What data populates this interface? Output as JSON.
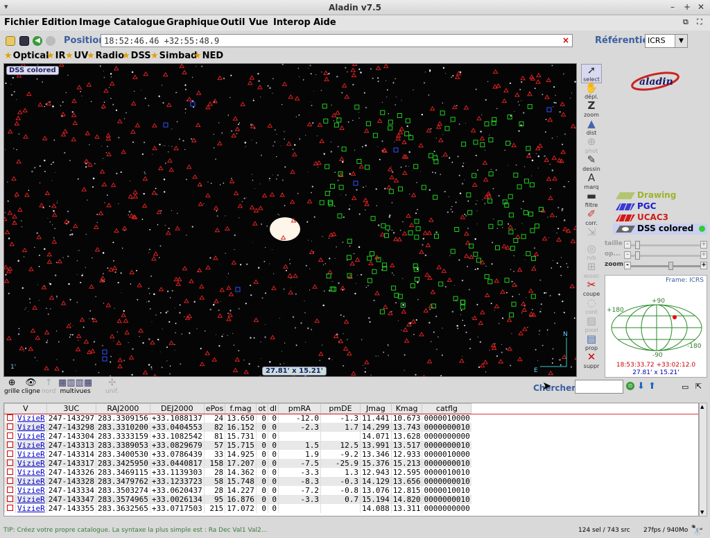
{
  "window": {
    "title": "Aladin v7.5"
  },
  "menu": [
    "Fichier",
    "Edition",
    "Image",
    "Catalogue",
    "Graphique",
    "Outil",
    "Vue",
    "Interop",
    "Aide"
  ],
  "position": {
    "label": "Position",
    "value": "18:52:46.46 +32:55:48.9",
    "clear": "×"
  },
  "frame": {
    "label": "Référentiel",
    "value": "ICRS"
  },
  "surveys": [
    "Optical",
    "IR",
    "UV",
    "Radio",
    "DSS",
    "Simbad",
    "NED"
  ],
  "view": {
    "tag": "DSS colored",
    "fov": "27.81' x 15.21'",
    "scale": "1'"
  },
  "tools": [
    {
      "label": "select",
      "glyph": "➚"
    },
    {
      "label": "dépl.",
      "glyph": "✋"
    },
    {
      "label": "zoom",
      "glyph": "Z"
    },
    {
      "label": "dist",
      "glyph": "▲"
    },
    {
      "label": "phot",
      "glyph": "⊕"
    },
    {
      "label": "dessin",
      "glyph": "✎"
    },
    {
      "label": "marq",
      "glyph": "A"
    },
    {
      "label": "filtre",
      "glyph": "▬"
    },
    {
      "label": "corr.",
      "glyph": "✐"
    },
    {
      "label": "",
      "glyph": "⇲"
    },
    {
      "label": "rvb",
      "glyph": "◎"
    },
    {
      "label": "assoc",
      "glyph": "⊞"
    },
    {
      "label": "coupe",
      "glyph": "✂"
    },
    {
      "label": "cont",
      "glyph": "◌"
    },
    {
      "label": "pixel",
      "glyph": "▨"
    },
    {
      "label": "prop",
      "glyph": "▤"
    },
    {
      "label": "suppr",
      "glyph": "✕"
    }
  ],
  "layers": [
    {
      "name": "Drawing",
      "color": "#9bb52a"
    },
    {
      "name": "PGC",
      "color": "#1a1ad0"
    },
    {
      "name": "UCAC3",
      "color": "#d01a1a"
    },
    {
      "name": "DSS colored",
      "color": "#000000"
    }
  ],
  "sliders": [
    {
      "label": "taille"
    },
    {
      "label": "op..."
    },
    {
      "label": "zoom"
    }
  ],
  "overview": {
    "frame": "Frame: ICRS",
    "top": "+90",
    "bottom": "-90",
    "left": "+180",
    "right": "-180",
    "coord1": "18:53:33.72 +33:02:12.0",
    "coord2": "27.81' x 15.21'"
  },
  "bottom_tools": [
    {
      "label": "grille",
      "glyph": "⊕"
    },
    {
      "label": "cligne",
      "glyph": "👁"
    },
    {
      "label": "nord",
      "glyph": "↑"
    },
    {
      "label": "multivues",
      "glyph": "▦▥▥▦"
    },
    {
      "label": "unif.",
      "glyph": "✣"
    }
  ],
  "search": {
    "label": "Chercher"
  },
  "table": {
    "headers": [
      "V",
      "3UC",
      "RAJ2000",
      "DEJ2000",
      "ePos",
      "f.mag",
      "ot",
      "dl",
      "pmRA",
      "pmDE",
      "Jmag",
      "Kmag",
      "catflg"
    ],
    "rows": [
      [
        "VizieR",
        "247-143297",
        "283.3309156",
        "+33.1088137",
        "24",
        "13.650",
        "0",
        "0",
        "-12.0",
        "-1.3",
        "11.441",
        "10.673",
        "0000010000"
      ],
      [
        "VizieR",
        "247-143298",
        "283.3310200",
        "+33.0404553",
        "82",
        "16.152",
        "0",
        "0",
        "-2.3",
        "1.7",
        "14.299",
        "13.743",
        "0000000010"
      ],
      [
        "VizieR",
        "247-143304",
        "283.3333159",
        "+33.1082542",
        "81",
        "15.731",
        "0",
        "0",
        "",
        "",
        "14.071",
        "13.628",
        "0000000000"
      ],
      [
        "VizieR",
        "247-143313",
        "283.3389053",
        "+33.0829679",
        "57",
        "15.715",
        "0",
        "0",
        "1.5",
        "12.5",
        "13.991",
        "13.517",
        "0000000010"
      ],
      [
        "VizieR",
        "247-143314",
        "283.3400530",
        "+33.0786439",
        "33",
        "14.925",
        "0",
        "0",
        "1.9",
        "-9.2",
        "13.346",
        "12.933",
        "0000010000"
      ],
      [
        "VizieR",
        "247-143317",
        "283.3425950",
        "+33.0440817",
        "158",
        "17.207",
        "0",
        "0",
        "-7.5",
        "-25.9",
        "15.376",
        "15.213",
        "0000000010"
      ],
      [
        "VizieR",
        "247-143326",
        "283.3469115",
        "+33.1139303",
        "28",
        "14.362",
        "0",
        "0",
        "-3.3",
        "1.3",
        "12.943",
        "12.595",
        "0000010010"
      ],
      [
        "VizieR",
        "247-143328",
        "283.3479762",
        "+33.1233723",
        "58",
        "15.748",
        "0",
        "0",
        "-8.3",
        "-0.3",
        "14.129",
        "13.656",
        "0000000010"
      ],
      [
        "VizieR",
        "247-143334",
        "283.3503274",
        "+33.0620437",
        "28",
        "14.227",
        "0",
        "0",
        "-7.2",
        "-0.8",
        "13.076",
        "12.815",
        "0000010010"
      ],
      [
        "VizieR",
        "247-143347",
        "283.3574965",
        "+33.0026134",
        "95",
        "16.876",
        "0",
        "0",
        "-3.3",
        "0.7",
        "15.194",
        "14.820",
        "0000000010"
      ],
      [
        "VizieR",
        "247-143355",
        "283.3632565",
        "+33.0717503",
        "215",
        "17.072",
        "0",
        "0",
        "",
        "",
        "14.088",
        "13.311",
        "0000000000"
      ]
    ]
  },
  "status": {
    "tip": "TIP: Créez votre propre catalogue. La syntaxe la plus simple est : Ra Dec Val1 Val2...",
    "selection": "124 sel / 743 src",
    "perf": "27fps / 940Mo"
  }
}
